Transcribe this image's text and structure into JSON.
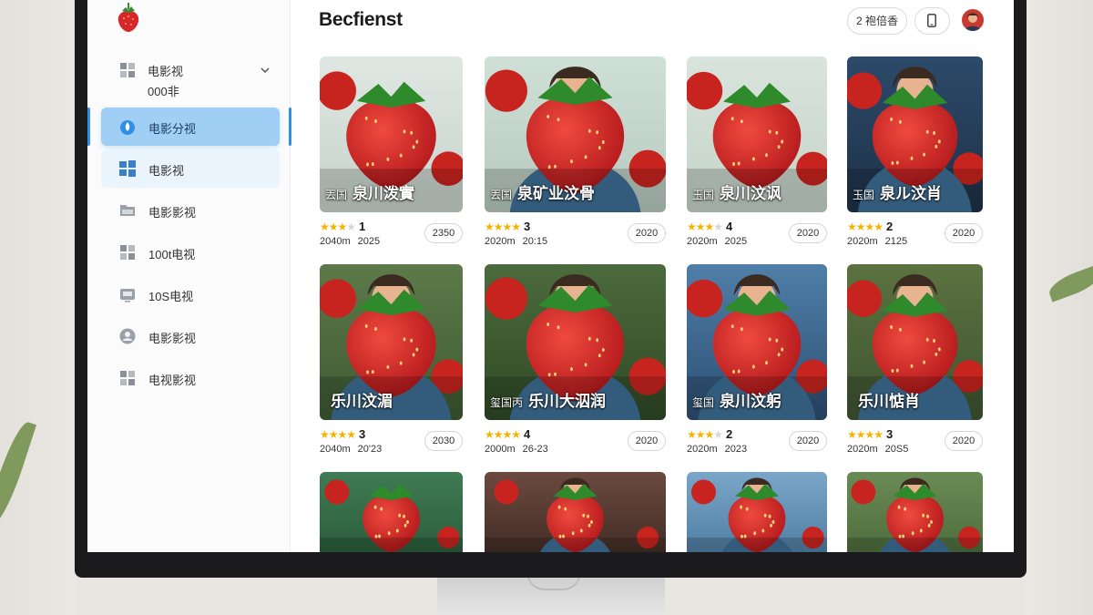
{
  "app": {
    "title": "Becfienst",
    "header_button_label": "2 袍倍香"
  },
  "sidebar": {
    "group": {
      "label": "电影视",
      "sub_label": "000非"
    },
    "items": [
      {
        "label": "电影分视",
        "icon": "flame-icon",
        "active": true
      },
      {
        "label": "电影视",
        "icon": "windows-grid-icon",
        "active": false
      },
      {
        "label": "电影影视",
        "icon": "folder-icon",
        "active": false
      },
      {
        "label": "100t电视",
        "icon": "grid-icon",
        "active": false
      },
      {
        "label": "10S电视",
        "icon": "tv-icon",
        "active": false
      },
      {
        "label": "电影影视",
        "icon": "user-circle-icon",
        "active": false
      },
      {
        "label": "电视影视",
        "icon": "grid-icon",
        "active": false
      }
    ]
  },
  "colors": {
    "accent": "#2f8fe6",
    "active_bg": "#9fcff5",
    "star": "#f4b400"
  },
  "movies": [
    {
      "title": "泉川泼實",
      "tag": "丟国",
      "stars": 3,
      "score": "1",
      "duration": "2040m",
      "year_text": "2025",
      "year_badge": "2350"
    },
    {
      "title": "泉矿业汶骨",
      "tag": "丟国",
      "stars": 4,
      "score": "3",
      "duration": "2020m",
      "year_text": "20:15",
      "year_badge": "2020"
    },
    {
      "title": "泉川汶讽",
      "tag": "玉国",
      "stars": 3,
      "score": "4",
      "duration": "2020m",
      "year_text": "2025",
      "year_badge": "2020"
    },
    {
      "title": "泉ル汶肖",
      "tag": "玉国",
      "stars": 4,
      "score": "2",
      "duration": "2020m",
      "year_text": "2125",
      "year_badge": "2020"
    },
    {
      "title": "乐川汶湄",
      "tag": "",
      "stars": 4,
      "score": "3",
      "duration": "2040m",
      "year_text": "20'23",
      "year_badge": "2030"
    },
    {
      "title": "乐川大泅润",
      "tag": "玺国丙",
      "stars": 4,
      "score": "4",
      "duration": "2000m",
      "year_text": "26-23",
      "year_badge": "2020"
    },
    {
      "title": "泉川汶躬",
      "tag": "玺国",
      "stars": 3,
      "score": "2",
      "duration": "2020m",
      "year_text": "2023",
      "year_badge": "2020"
    },
    {
      "title": "乐川惦肖",
      "tag": "",
      "stars": 4,
      "score": "3",
      "duration": "2020m",
      "year_text": "20S5",
      "year_badge": "2020"
    },
    {
      "title": "",
      "tag": "",
      "stars": 0,
      "score": "",
      "duration": "",
      "year_text": "",
      "year_badge": ""
    },
    {
      "title": "",
      "tag": "",
      "stars": 0,
      "score": "",
      "duration": "",
      "year_text": "",
      "year_badge": ""
    },
    {
      "title": "",
      "tag": "",
      "stars": 0,
      "score": "",
      "duration": "",
      "year_text": "",
      "year_badge": ""
    },
    {
      "title": "",
      "tag": "",
      "stars": 0,
      "score": "",
      "duration": "",
      "year_text": "",
      "year_badge": ""
    }
  ]
}
